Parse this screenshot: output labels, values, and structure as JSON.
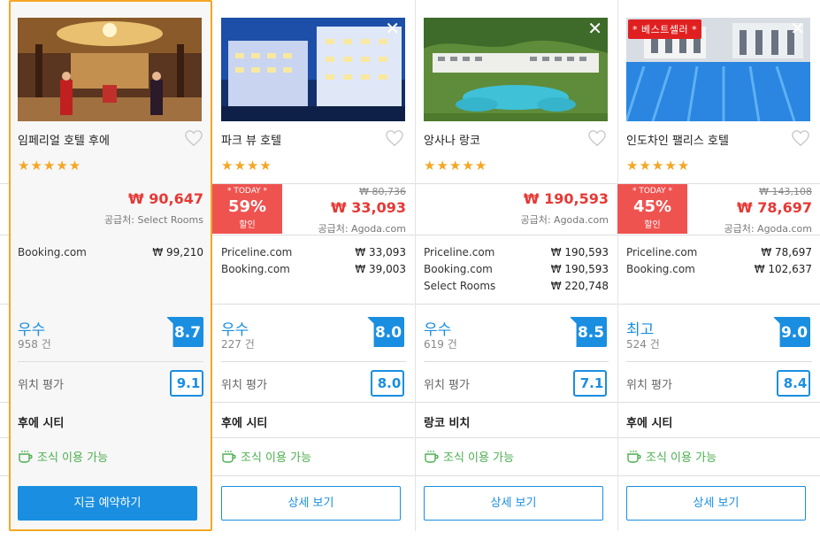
{
  "hotels": [
    {
      "name": "임페리얼 호텔 후에",
      "stars": "★★★★★",
      "price": "₩ 90,647",
      "supplier": "공급처: Select Rooms",
      "offers": [
        {
          "site": "Booking.com",
          "price": "₩ 99,210"
        }
      ],
      "rating_word": "우수",
      "reviews": "958 건",
      "score": "8.7",
      "location_label": "위치 평가",
      "location_score": "9.1",
      "area": "후에 시티",
      "breakfast": "조식 이용 가능",
      "button": "지금 예약하기"
    },
    {
      "name": "파크 뷰 호텔",
      "stars": "★★★★",
      "today_label": "* TODAY *",
      "discount": "59%",
      "discount_label": "할인",
      "old_price": "₩ 80,736",
      "price": "₩ 33,093",
      "supplier": "공급처: Agoda.com",
      "offers": [
        {
          "site": "Priceline.com",
          "price": "₩ 33,093"
        },
        {
          "site": "Booking.com",
          "price": "₩ 39,003"
        }
      ],
      "rating_word": "우수",
      "reviews": "227 건",
      "score": "8.0",
      "location_label": "위치 평가",
      "location_score": "8.0",
      "area": "후에 시티",
      "breakfast": "조식 이용 가능",
      "button": "상세 보기"
    },
    {
      "name": "앙사나 랑코",
      "stars": "★★★★★",
      "price": "₩ 190,593",
      "supplier": "공급처: Agoda.com",
      "offers": [
        {
          "site": "Priceline.com",
          "price": "₩ 190,593"
        },
        {
          "site": "Booking.com",
          "price": "₩ 190,593"
        },
        {
          "site": "Select Rooms",
          "price": "₩ 220,748"
        }
      ],
      "rating_word": "우수",
      "reviews": "619 건",
      "score": "8.5",
      "location_label": "위치 평가",
      "location_score": "7.1",
      "area": "랑코 비치",
      "breakfast": "조식 이용 가능",
      "button": "상세 보기"
    },
    {
      "name": "인도차인 팰리스 호텔",
      "stars": "★★★★★",
      "badge": "* 베스트셀러 *",
      "today_label": "* TODAY *",
      "discount": "45%",
      "discount_label": "할인",
      "old_price": "₩ 143,108",
      "price": "₩ 78,697",
      "supplier": "공급처: Agoda.com",
      "offers": [
        {
          "site": "Priceline.com",
          "price": "₩ 78,697"
        },
        {
          "site": "Booking.com",
          "price": "₩ 102,637"
        }
      ],
      "rating_word": "최고",
      "reviews": "524 건",
      "score": "9.0",
      "location_label": "위치 평가",
      "location_score": "8.4",
      "area": "후에 시티",
      "breakfast": "조식 이용 가능",
      "button": "상세 보기"
    }
  ],
  "close_glyph": "✕",
  "colors": {
    "accent": "#1a8ee0",
    "price": "#e53935",
    "discount_bg": "#ef5350",
    "selected_border": "#f5a623",
    "breakfast": "#4caf50"
  }
}
